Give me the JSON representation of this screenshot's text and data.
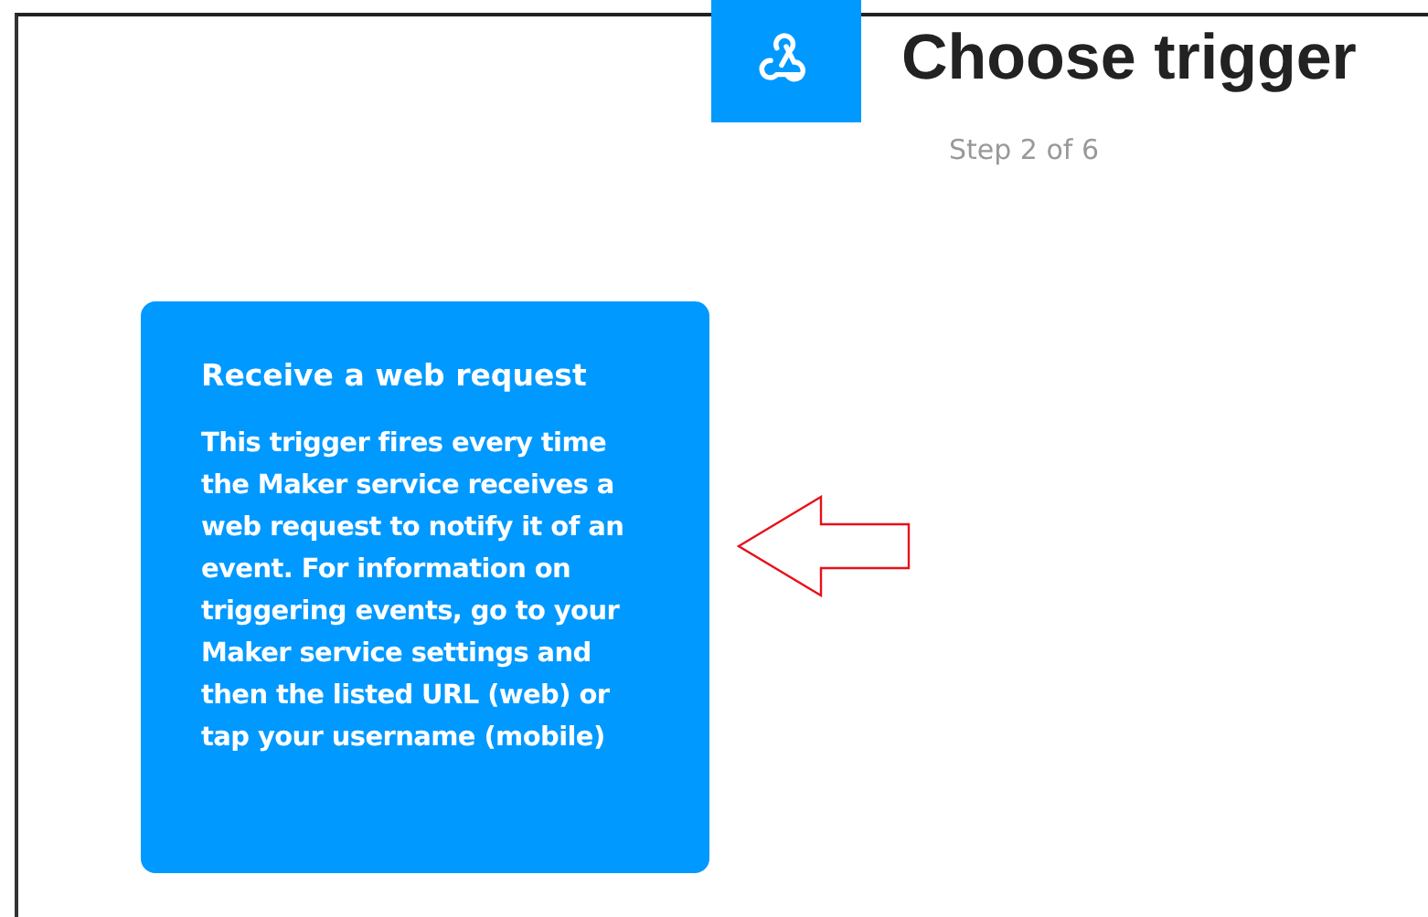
{
  "header": {
    "title": "Choose trigger",
    "step": "Step 2 of 6"
  },
  "trigger_card": {
    "title": "Receive a web request",
    "description": "This trigger fires every time the Maker service receives a web request to notify it of an event. For information on triggering events, go to your Maker service settings and then the listed URL (web) or tap your username (mobile)"
  }
}
